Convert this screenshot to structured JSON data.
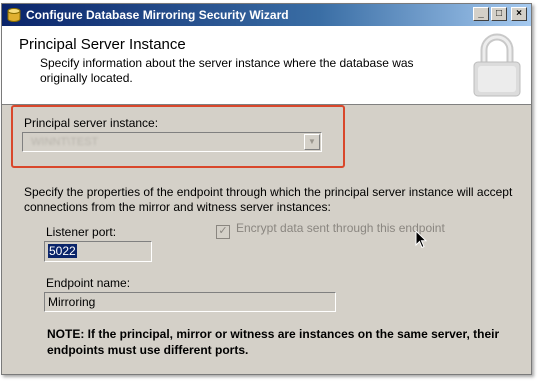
{
  "window": {
    "title": "Configure Database Mirroring Security Wizard",
    "controls": {
      "minimize": "_",
      "maximize": "□",
      "close": "×"
    }
  },
  "header": {
    "title": "Principal Server Instance",
    "subtitle": "Specify information about the server instance where the database was originally located."
  },
  "principal": {
    "label": "Principal server instance:",
    "value": "WINNT\\TEST"
  },
  "description": "Specify the properties of the endpoint through which the principal server instance will accept connections from the mirror and witness server instances:",
  "listener": {
    "label": "Listener port:",
    "value": "5022"
  },
  "encrypt": {
    "label": "Encrypt data sent through this endpoint",
    "checked": true
  },
  "endpoint": {
    "label": "Endpoint name:",
    "value": "Mirroring"
  },
  "note": "NOTE: If the principal, mirror or witness are instances on the same server, their endpoints must use different ports.",
  "colors": {
    "title_bar_start": "#0a246a",
    "title_bar_end": "#a6caf0",
    "highlight_border": "#d9472b",
    "dialog_bg": "#d4d0c8"
  }
}
